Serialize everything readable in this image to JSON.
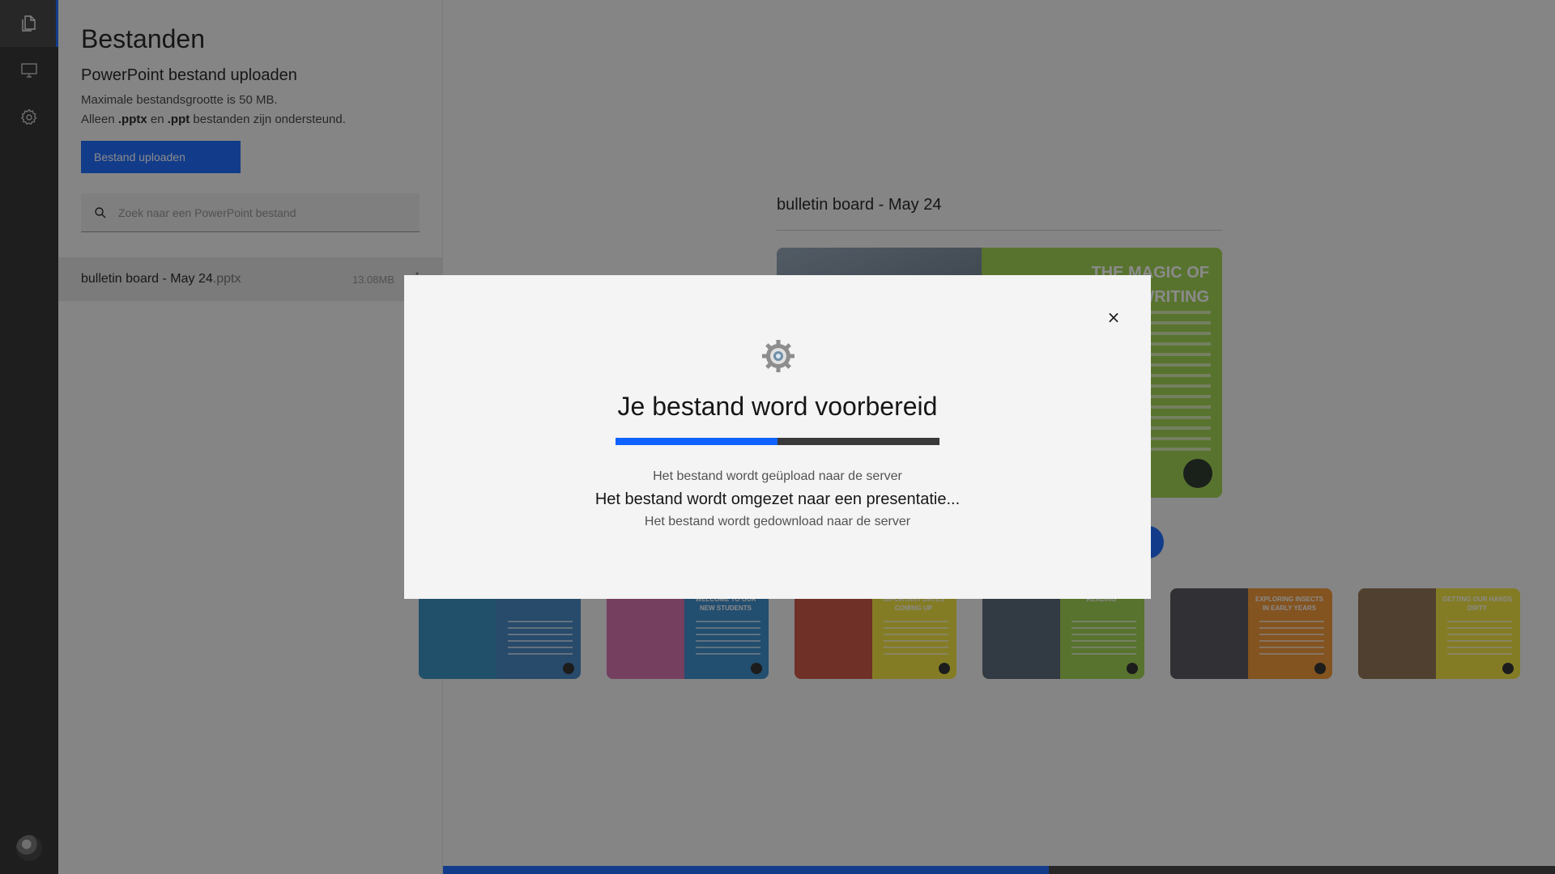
{
  "sidebar": {
    "icons": [
      "files-icon",
      "presentation-icon",
      "settings-icon"
    ]
  },
  "files_panel": {
    "title": "Bestanden",
    "subtitle": "PowerPoint bestand uploaden",
    "max_size": "Maximale bestandsgrootte is 50 MB.",
    "supported_prefix": "Alleen ",
    "ext1": ".pptx",
    "supported_mid": " en ",
    "ext2": ".ppt",
    "supported_suffix": " bestanden zijn ondersteund.",
    "upload_button": "Bestand uploaden",
    "search_placeholder": "Zoek naar een PowerPoint bestand",
    "files": [
      {
        "name": "bulletin board - May 24",
        "ext": ".pptx",
        "size": "13.08MB"
      }
    ]
  },
  "main": {
    "presentation_title": "bulletin board - May 24",
    "preview_title": "THE MAGIC OF WRITING",
    "slides": [
      {
        "title": "",
        "color": "#3a7fc1",
        "photo": "#2c8bbf"
      },
      {
        "title": "WELCOME TO OUR NEW STUDENTS",
        "color": "#2f86c8",
        "photo": "#d46aa8"
      },
      {
        "title": "IMPORTANT DATES COMING UP",
        "color": "#f2e234",
        "photo": "#c94b3a"
      },
      {
        "title": "READING",
        "color": "#9bd046",
        "photo": "#4f5f70"
      },
      {
        "title": "EXPLORING INSECTS IN EARLY YEARS",
        "color": "#f0902a",
        "photo": "#4b4b55"
      },
      {
        "title": "GETTING OUR HANDS DIRTY",
        "color": "#f2e234",
        "photo": "#8a6a4a"
      }
    ],
    "bottom_progress": 0.545
  },
  "modal": {
    "title": "Je bestand word voorbereid",
    "progress": 0.5,
    "steps": [
      "Het bestand wordt geüpload naar de server",
      "Het bestand wordt omgezet naar een presentatie...",
      "Het bestand wordt gedownload naar de server"
    ],
    "close_label": "×"
  },
  "colors": {
    "accent": "#0f62fe",
    "rail": "#262626",
    "overlay": "rgba(22,22,22,0.5)"
  }
}
